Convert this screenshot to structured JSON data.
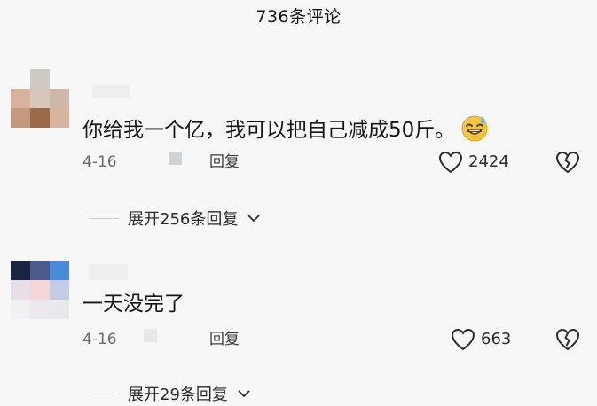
{
  "header": {
    "title": "736条评论"
  },
  "comments": [
    {
      "text": "你给我一个亿，我可以把自己减成50斤。",
      "emoji": "grinning-sweat-emoji",
      "date": "4-16",
      "reply_label": "回复",
      "likes": "2424",
      "expand_label": "展开256条回复"
    },
    {
      "text": "一天没完了",
      "date": "4-16",
      "reply_label": "回复",
      "likes": "663",
      "expand_label": "展开29条回复"
    }
  ],
  "colors": {
    "background": "#f7f7f7",
    "text": "#161616",
    "muted": "#6b6b6b",
    "emoji_face": "#f4c542"
  }
}
